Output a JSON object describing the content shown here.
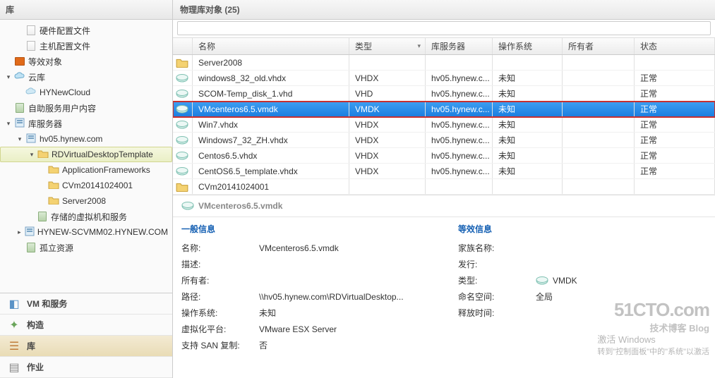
{
  "nav": {
    "header": "库",
    "tree": [
      {
        "label": "硬件配置文件",
        "icon": "file",
        "indent": 1
      },
      {
        "label": "主机配置文件",
        "icon": "file",
        "indent": 1
      },
      {
        "label": "等效对象",
        "icon": "obj",
        "indent": 0
      },
      {
        "label": "云库",
        "icon": "cloud",
        "indent": 0,
        "expander": "▾"
      },
      {
        "label": "HYNewCloud",
        "icon": "cloud-l",
        "indent": 1
      },
      {
        "label": "自助服务用户内容",
        "icon": "server",
        "indent": 0
      },
      {
        "label": "库服务器",
        "icon": "host",
        "indent": 0,
        "expander": "▾"
      },
      {
        "label": "hv05.hynew.com",
        "icon": "host",
        "indent": 1,
        "expander": "▾"
      },
      {
        "label": "RDVirtualDesktopTemplate",
        "icon": "folder",
        "indent": 2,
        "expander": "▾",
        "selected": true
      },
      {
        "label": "ApplicationFrameworks",
        "icon": "folder",
        "indent": 3
      },
      {
        "label": "CVm20141024001",
        "icon": "folder",
        "indent": 3
      },
      {
        "label": "Server2008",
        "icon": "folder",
        "indent": 3
      },
      {
        "label": "存储的虚拟机和服务",
        "icon": "server",
        "indent": 2
      },
      {
        "label": "HYNEW-SCVMM02.HYNEW.COM",
        "icon": "host",
        "indent": 1,
        "expander": "▸"
      },
      {
        "label": "孤立资源",
        "icon": "server",
        "indent": 1
      }
    ]
  },
  "wunderbar": [
    {
      "label": "VM 和服务",
      "icon": "vm"
    },
    {
      "label": "构造",
      "icon": "fabric"
    },
    {
      "label": "库",
      "icon": "library",
      "active": true
    },
    {
      "label": "作业",
      "icon": "jobs"
    }
  ],
  "content": {
    "header": "物理库对象 (25)",
    "search_placeholder": "",
    "columns": [
      "",
      "名称",
      "类型",
      "库服务器",
      "操作系统",
      "所有者",
      "状态"
    ],
    "sort_col": 2,
    "rows": [
      {
        "icon": "folder",
        "name": "Server2008",
        "type": "",
        "srv": "",
        "os": "",
        "owner": "",
        "status": ""
      },
      {
        "icon": "disk",
        "name": "windows8_32_old.vhdx",
        "type": "VHDX",
        "srv": "hv05.hynew.c...",
        "os": "未知",
        "owner": "",
        "status": "正常"
      },
      {
        "icon": "disk",
        "name": "SCOM-Temp_disk_1.vhd",
        "type": "VHD",
        "srv": "hv05.hynew.c...",
        "os": "未知",
        "owner": "",
        "status": "正常"
      },
      {
        "icon": "disk",
        "name": "VMcenteros6.5.vmdk",
        "type": "VMDK",
        "srv": "hv05.hynew.c...",
        "os": "未知",
        "owner": "",
        "status": "正常",
        "selected": true
      },
      {
        "icon": "disk",
        "name": "Win7.vhdx",
        "type": "VHDX",
        "srv": "hv05.hynew.c...",
        "os": "未知",
        "owner": "",
        "status": "正常"
      },
      {
        "icon": "disk",
        "name": "Windows7_32_ZH.vhdx",
        "type": "VHDX",
        "srv": "hv05.hynew.c...",
        "os": "未知",
        "owner": "",
        "status": "正常"
      },
      {
        "icon": "disk",
        "name": "Centos6.5.vhdx",
        "type": "VHDX",
        "srv": "hv05.hynew.c...",
        "os": "未知",
        "owner": "",
        "status": "正常"
      },
      {
        "icon": "disk",
        "name": "CentOS6.5_template.vhdx",
        "type": "VHDX",
        "srv": "hv05.hynew.c...",
        "os": "未知",
        "owner": "",
        "status": "正常"
      },
      {
        "icon": "folder",
        "name": "CVm20141024001",
        "type": "",
        "srv": "",
        "os": "",
        "owner": "",
        "status": ""
      }
    ]
  },
  "detail": {
    "title": "VMcenteros6.5.vmdk",
    "left_section": "一般信息",
    "right_section": "等效信息",
    "left": [
      {
        "k": "名称:",
        "v": "VMcenteros6.5.vmdk"
      },
      {
        "k": "描述:",
        "v": ""
      },
      {
        "k": "所有者:",
        "v": ""
      },
      {
        "k": "路径:",
        "v": "\\\\hv05.hynew.com\\RDVirtualDesktop..."
      },
      {
        "k": "操作系统:",
        "v": "未知"
      },
      {
        "k": "虚拟化平台:",
        "v": "VMware ESX Server"
      },
      {
        "k": "支持 SAN 复制:",
        "v": "否"
      }
    ],
    "right": [
      {
        "k": "家族名称:",
        "v": ""
      },
      {
        "k": "发行:",
        "v": ""
      },
      {
        "k": "类型:",
        "v": "VMDK",
        "icon": true
      },
      {
        "k": "命名空间:",
        "v": "全局"
      },
      {
        "k": "释放时间:",
        "v": ""
      }
    ]
  },
  "watermark": {
    "line1": "激活 Windows",
    "line2": "转到\"控制面板\"中的\"系统\"以激活"
  },
  "watermark2": {
    "main": "51CTO.com",
    "sub": "技术博客   Blog"
  }
}
